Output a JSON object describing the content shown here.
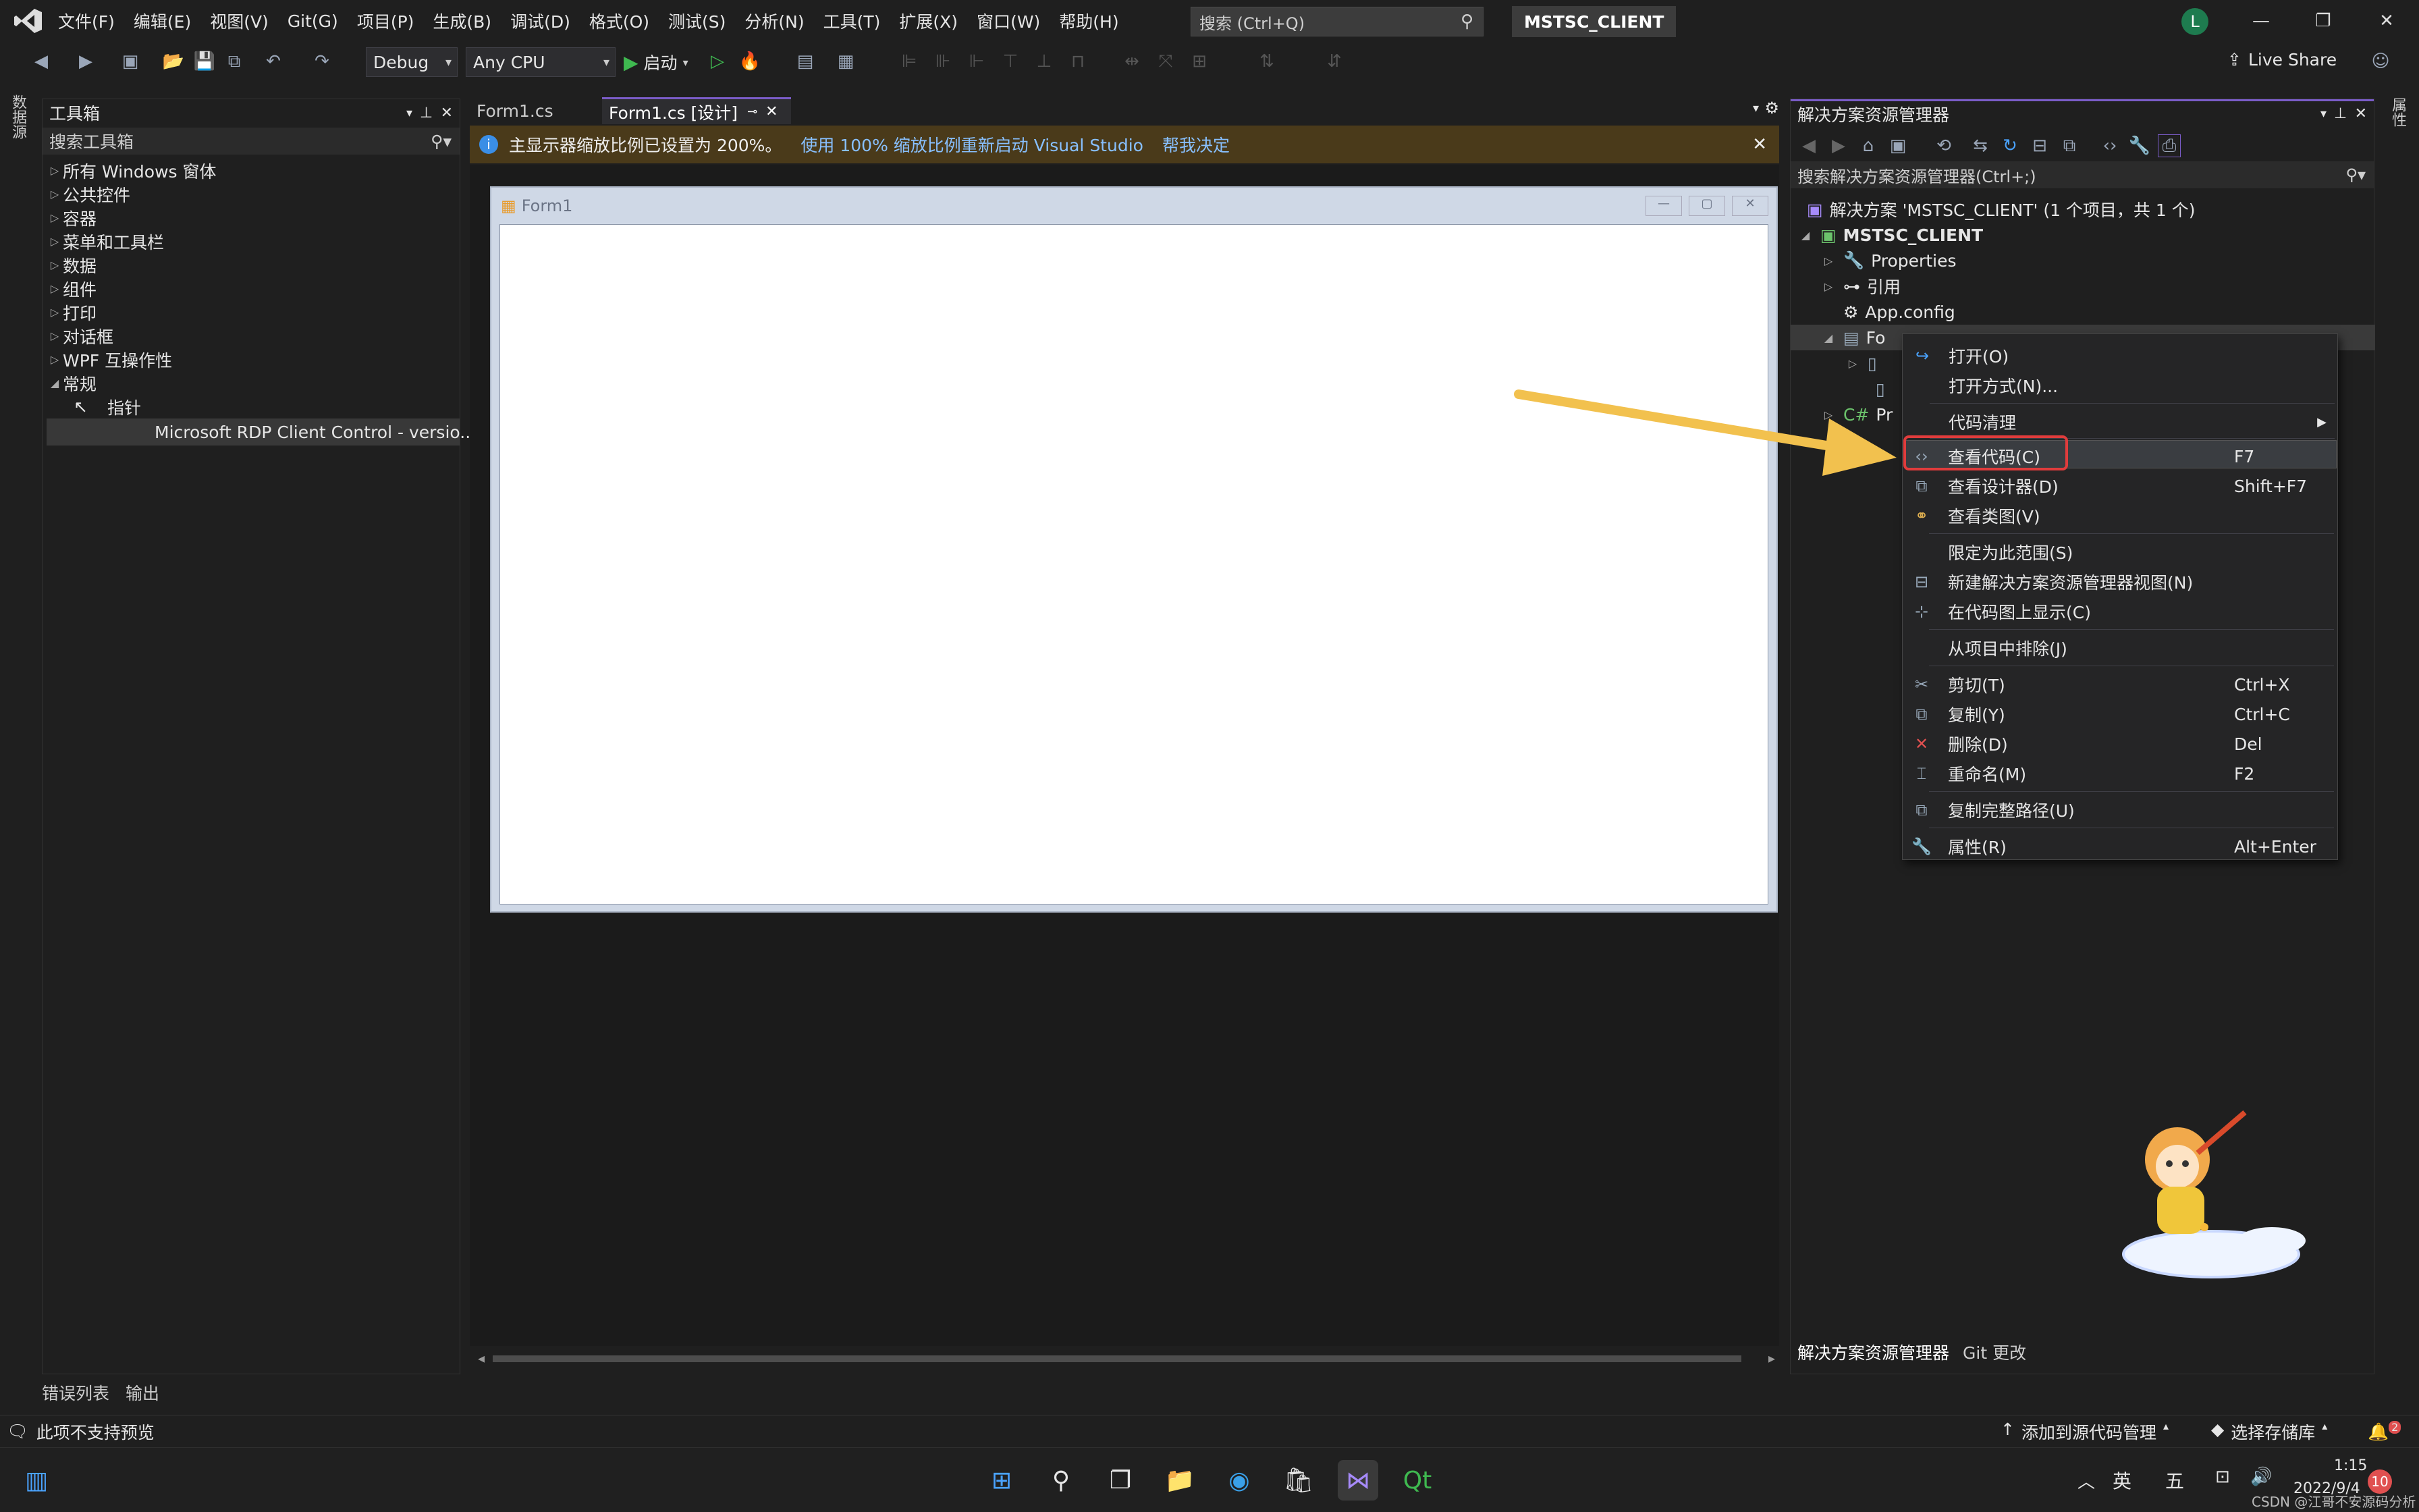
{
  "menubar": {
    "items": [
      "文件(F)",
      "编辑(E)",
      "视图(V)",
      "Git(G)",
      "项目(P)",
      "生成(B)",
      "调试(D)",
      "格式(O)",
      "测试(S)",
      "分析(N)",
      "工具(T)",
      "扩展(X)",
      "窗口(W)",
      "帮助(H)"
    ],
    "search_placeholder": "搜索 (Ctrl+Q)",
    "solution_badge": "MSTSC_CLIENT",
    "avatar_letter": "L"
  },
  "toolbar": {
    "config": "Debug",
    "platform": "Any CPU",
    "start_label": "启动",
    "live_share": "Live Share"
  },
  "left_strip": {
    "label": "数据源"
  },
  "right_strip": {
    "label": "属性"
  },
  "toolbox": {
    "title": "工具箱",
    "search_placeholder": "搜索工具箱",
    "groups": [
      "所有 Windows 窗体",
      "公共控件",
      "容器",
      "菜单和工具栏",
      "数据",
      "组件",
      "打印",
      "对话框",
      "WPF 互操作性",
      "常规"
    ],
    "pointer": "指针",
    "selected_item": "Microsoft RDP Client Control - versio..."
  },
  "bottom_tabs": [
    "错误列表",
    "输出"
  ],
  "doc_tabs": {
    "tab1": "Form1.cs",
    "tab2": "Form1.cs [设计]"
  },
  "infobar": {
    "message": "主显示器缩放比例已设置为 200%。",
    "link1": "使用 100% 缩放比例重新启动 Visual Studio",
    "link2": "帮我决定"
  },
  "form": {
    "title": "Form1"
  },
  "solution_explorer": {
    "title": "解决方案资源管理器",
    "search_placeholder": "搜索解决方案资源管理器(Ctrl+;)",
    "solution_node": "解决方案 'MSTSC_CLIENT' (1 个项目，共 1 个)",
    "project_node": "MSTSC_CLIENT",
    "properties": "Properties",
    "references": "引用",
    "app_config": "App.config",
    "form_node": "Fo",
    "program_node": "Pr",
    "bottom_tabs": [
      "解决方案资源管理器",
      "Git 更改"
    ]
  },
  "context_menu": {
    "items": [
      {
        "label": "打开(O)",
        "shortcut": "",
        "icon": "open-icon"
      },
      {
        "label": "打开方式(N)...",
        "shortcut": "",
        "icon": ""
      },
      {
        "label": "代码清理",
        "shortcut": "",
        "icon": "",
        "submenu": true
      },
      {
        "label": "查看代码(C)",
        "shortcut": "F7",
        "icon": "code-icon"
      },
      {
        "label": "查看设计器(D)",
        "shortcut": "Shift+F7",
        "icon": "designer-icon"
      },
      {
        "label": "查看类图(V)",
        "shortcut": "",
        "icon": "class-diagram-icon"
      },
      {
        "label": "限定为此范围(S)",
        "shortcut": "",
        "icon": ""
      },
      {
        "label": "新建解决方案资源管理器视图(N)",
        "shortcut": "",
        "icon": "new-view-icon"
      },
      {
        "label": "在代码图上显示(C)",
        "shortcut": "",
        "icon": "code-map-icon"
      },
      {
        "label": "从项目中排除(J)",
        "shortcut": "",
        "icon": ""
      },
      {
        "label": "剪切(T)",
        "shortcut": "Ctrl+X",
        "icon": "cut-icon"
      },
      {
        "label": "复制(Y)",
        "shortcut": "Ctrl+C",
        "icon": "copy-icon"
      },
      {
        "label": "删除(D)",
        "shortcut": "Del",
        "icon": "delete-icon"
      },
      {
        "label": "重命名(M)",
        "shortcut": "F2",
        "icon": "rename-icon"
      },
      {
        "label": "复制完整路径(U)",
        "shortcut": "",
        "icon": "copy-path-icon"
      },
      {
        "label": "属性(R)",
        "shortcut": "Alt+Enter",
        "icon": "wrench-icon"
      }
    ]
  },
  "statusbar": {
    "left": "此项不支持预览",
    "source_control": "添加到源代码管理",
    "repo": "选择存储库",
    "notif_count": "2"
  },
  "taskbar": {
    "ime1": "英",
    "ime2": "五",
    "time": "1:15",
    "date": "2022/9/4",
    "badge": "10",
    "watermark": "CSDN @江哥不安源码分析"
  },
  "colors": {
    "accent": "#7a5cc7",
    "arrow": "#f2c14e",
    "highlight_box": "#e03c3c",
    "link": "#88c0ff"
  }
}
